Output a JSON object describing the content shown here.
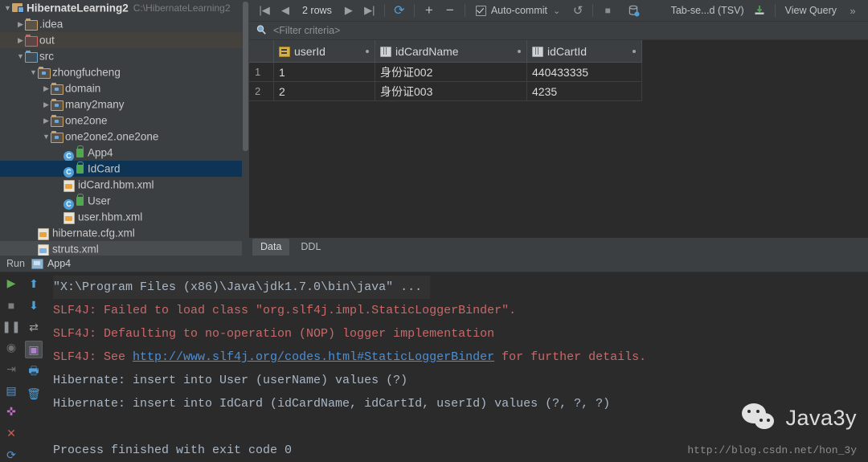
{
  "project_tree": {
    "scrollbar": "vertical-scrollbar",
    "items": [
      {
        "label": "HibernateLearning2",
        "hint": "C:\\HibernateLearning2",
        "indent": 0,
        "twisty": "▼",
        "icon": "module-icon",
        "state": "bold"
      },
      {
        "label": ".idea",
        "hint": "",
        "indent": 1,
        "twisty": "▶",
        "icon": "folder-icon",
        "state": "normal"
      },
      {
        "label": "out",
        "hint": "",
        "indent": 1,
        "twisty": "▶",
        "icon": "folder-red-icon",
        "state": "warm"
      },
      {
        "label": "src",
        "hint": "",
        "indent": 1,
        "twisty": "▼",
        "icon": "folder-blue-icon",
        "state": "normal"
      },
      {
        "label": "zhongfucheng",
        "hint": "",
        "indent": 2,
        "twisty": "▼",
        "icon": "package-icon",
        "state": "normal"
      },
      {
        "label": "domain",
        "hint": "",
        "indent": 3,
        "twisty": "▶",
        "icon": "package-icon",
        "state": "normal"
      },
      {
        "label": "many2many",
        "hint": "",
        "indent": 3,
        "twisty": "▶",
        "icon": "package-icon",
        "state": "normal"
      },
      {
        "label": "one2one",
        "hint": "",
        "indent": 3,
        "twisty": "▶",
        "icon": "package-icon",
        "state": "normal"
      },
      {
        "label": "one2one2.one2one",
        "hint": "",
        "indent": 3,
        "twisty": "▼",
        "icon": "package-icon",
        "state": "normal"
      },
      {
        "label": "App4",
        "hint": "",
        "indent": 4,
        "twisty": "",
        "icon": "java-class-icon",
        "state": "normal"
      },
      {
        "label": "IdCard",
        "hint": "",
        "indent": 4,
        "twisty": "",
        "icon": "java-class-icon",
        "state": "selected"
      },
      {
        "label": "idCard.hbm.xml",
        "hint": "",
        "indent": 4,
        "twisty": "",
        "icon": "xml-file-icon",
        "state": "normal"
      },
      {
        "label": "User",
        "hint": "",
        "indent": 4,
        "twisty": "",
        "icon": "java-class-icon",
        "state": "normal"
      },
      {
        "label": "user.hbm.xml",
        "hint": "",
        "indent": 4,
        "twisty": "",
        "icon": "xml-file-icon",
        "state": "normal"
      },
      {
        "label": "hibernate.cfg.xml",
        "hint": "",
        "indent": 2,
        "twisty": "",
        "icon": "xml-file-icon",
        "state": "normal"
      },
      {
        "label": "struts.xml",
        "hint": "",
        "indent": 2,
        "twisty": "",
        "icon": "xml-struts-icon",
        "state": "faint"
      }
    ]
  },
  "db_panel": {
    "toolbar": {
      "first_page": "|◀",
      "prev_page": "◀",
      "rows_count": "2 rows",
      "next_page": "▶",
      "last_page": "▶|",
      "reload": "⟳",
      "add_row": "+",
      "remove_row": "−",
      "auto_commit": "Auto-commit",
      "auto_commit_caret": "⌄",
      "rollback": "↺",
      "stop": "■",
      "transaction": "db-transaction-icon",
      "output_format": "Tab-se...d (TSV)",
      "export": "export-icon",
      "view_query": "View Query",
      "overflow": "»"
    },
    "filter": {
      "icon": "filter-search-icon",
      "placeholder": "<Filter criteria>"
    },
    "grid": {
      "columns": [
        {
          "label": "userId",
          "icon": "primary-key-icon"
        },
        {
          "label": "idCardName",
          "icon": "column-icon"
        },
        {
          "label": "idCartId",
          "icon": "column-icon"
        }
      ],
      "rows": [
        {
          "num": "1",
          "userId": "1",
          "idCardName": "身份证002",
          "idCartId": "440433335"
        },
        {
          "num": "2",
          "userId": "2",
          "idCardName": "身份证003",
          "idCartId": "4235"
        }
      ]
    },
    "tabs": [
      {
        "label": "Data",
        "active": true
      },
      {
        "label": "DDL",
        "active": false
      }
    ]
  },
  "run_panel": {
    "tab_bar_label": "Run",
    "tab_label": "App4",
    "gutter_left": [
      {
        "name": "rerun-icon",
        "glyph": "▶",
        "color": "#5fad4e"
      },
      {
        "name": "stop-icon",
        "glyph": "■",
        "color": "#7b7f82"
      },
      {
        "name": "pause-icon",
        "glyph": "❚❚",
        "color": "#8f9396"
      },
      {
        "name": "camera-icon",
        "glyph": "◉",
        "color": "#6c7073"
      },
      {
        "name": "exit-icon",
        "glyph": "⇥",
        "color": "#6c7073"
      },
      {
        "name": "console-icon",
        "glyph": "▤",
        "color": "#6f8fb0"
      },
      {
        "name": "pin-icon",
        "glyph": "✜",
        "color": "#c06fc0"
      },
      {
        "name": "close-icon",
        "glyph": "✕",
        "color": "#d0584f"
      },
      {
        "name": "settings-icon",
        "glyph": "⟳",
        "color": "#5f8fc4"
      }
    ],
    "gutter_right": [
      {
        "name": "scroll-up-icon",
        "glyph": "⬆",
        "color": "#4f9fd8"
      },
      {
        "name": "scroll-down-icon",
        "glyph": "⬇",
        "color": "#4f9fd8"
      },
      {
        "name": "soft-wrap-icon",
        "glyph": "⇄",
        "color": "#9aa0a4"
      },
      {
        "name": "print-console-icon",
        "glyph": "▣",
        "color": "#b07fd0"
      },
      {
        "name": "printer-icon",
        "glyph": "🖶",
        "color": "#4f9fd8"
      },
      {
        "name": "clear-all-icon",
        "glyph": "🗑",
        "color": "#4f9fd8"
      }
    ],
    "console_lines": [
      {
        "type": "cmd",
        "text": "\"X:\\Program Files (x86)\\Java\\jdk1.7.0\\bin\\java\" ..."
      },
      {
        "type": "err",
        "text": "SLF4J: Failed to load class \"org.slf4j.impl.StaticLoggerBinder\"."
      },
      {
        "type": "err",
        "text": "SLF4J: Defaulting to no-operation (NOP) logger implementation"
      },
      {
        "type": "err-link",
        "prefix": "SLF4J: See ",
        "link": "http://www.slf4j.org/codes.html#StaticLoggerBinder",
        "suffix": " for further details."
      },
      {
        "type": "out",
        "text": "Hibernate: insert into User (userName) values (?)"
      },
      {
        "type": "out",
        "text": "Hibernate: insert into IdCard (idCardName, idCartId, userId) values (?, ?, ?)"
      },
      {
        "type": "out",
        "text": ""
      },
      {
        "type": "out",
        "text": "Process finished with exit code 0"
      }
    ]
  },
  "watermark": {
    "icon": "wechat-icon",
    "name": "Java3y",
    "url": "http://blog.csdn.net/hon_3y"
  },
  "colors": {
    "panel_bg": "#3c3f41",
    "console_bg": "#2b2b2b",
    "selection": "#0d3355",
    "error_text": "#c96969",
    "link": "#4e8fd4",
    "accent": "#4f9fd8"
  }
}
